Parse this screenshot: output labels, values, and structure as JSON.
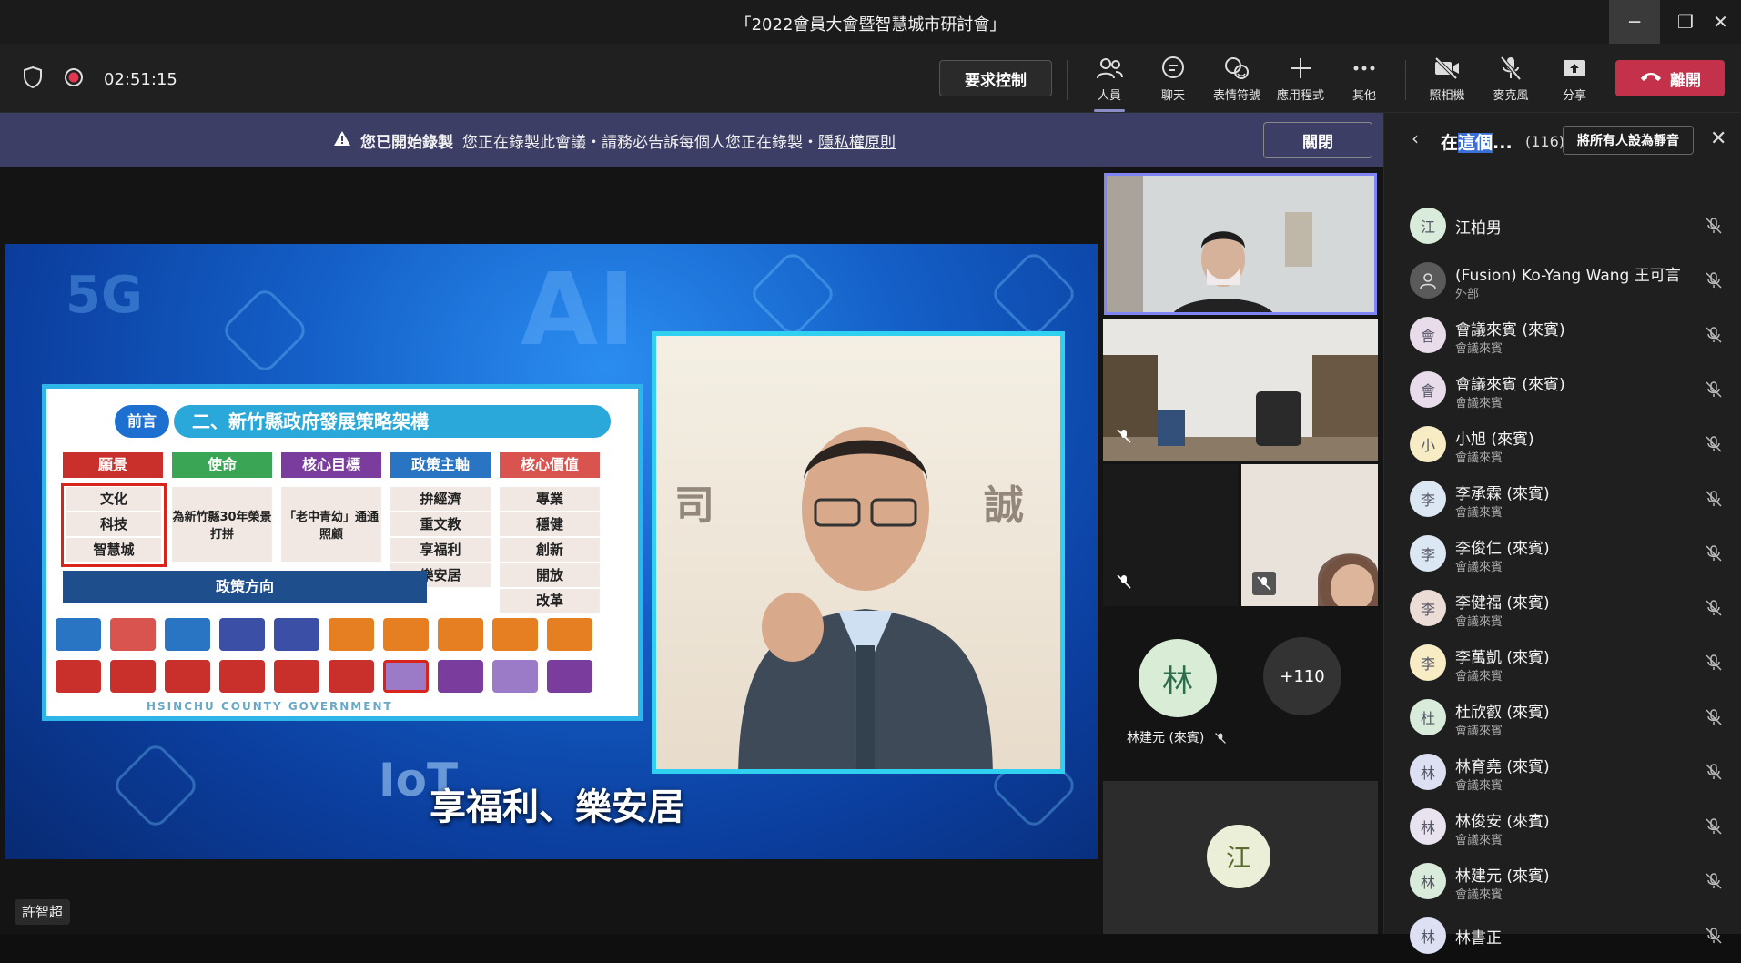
{
  "window": {
    "title": "「2022會員大會暨智慧城市研討會」",
    "minimize": "─",
    "restore": "❐",
    "close": "✕"
  },
  "toolbar": {
    "timer": "02:51:15",
    "request_control": "要求控制",
    "items": {
      "people": "人員",
      "chat": "聊天",
      "reactions": "表情符號",
      "apps": "應用程式",
      "more": "其他",
      "camera": "照相機",
      "mic": "麥克風",
      "share": "分享"
    },
    "leave": "離開"
  },
  "banner": {
    "bold": "您已開始錄製",
    "text": "您正在錄製此會議・請務必告訴每個人您正在錄製・",
    "link": "隱私權原則",
    "close": "關閉"
  },
  "slide": {
    "tag": "前言",
    "title": "二、新竹縣政府發展策略架構",
    "headers": [
      "願景",
      "使命",
      "核心目標",
      "政策主軸",
      "核心價值"
    ],
    "vision": [
      "文化",
      "科技",
      "智慧城"
    ],
    "mission": "為新竹縣30年榮景打拼",
    "goal": "「老中青幼」通通照顧",
    "policy_axes": [
      "拚經濟",
      "重文教",
      "享福利",
      "樂安居"
    ],
    "values": [
      "專業",
      "穩健",
      "創新",
      "開放",
      "改革"
    ],
    "policy_direction": "政策方向",
    "footer": "HSINCHU COUNTY GOVERNMENT",
    "caption": "享福利、樂安居",
    "overlay_words": [
      "5G",
      "AI",
      "IoT"
    ]
  },
  "presenter_name": "許智超",
  "tiles": {
    "avatar_initial": "林",
    "avatar_name": "林建元 (來賓)",
    "more_count": "+110",
    "bottom_initial": "江"
  },
  "panel": {
    "title": "在這個...",
    "title_sel": "這個",
    "count": "(116)",
    "mute_all": "將所有人設為靜音",
    "participants": [
      {
        "initial": "江",
        "name": "江柏男",
        "sub": "",
        "color": "#d9ecdc"
      },
      {
        "initial": "",
        "name": "(Fusion) Ko-Yang Wang 王可言",
        "sub": "外部",
        "color": "#5a5a5a"
      },
      {
        "initial": "會",
        "name": "會議來賓 (來賓)",
        "sub": "會議來賓",
        "color": "#e9dcea"
      },
      {
        "initial": "會",
        "name": "會議來賓 (來賓)",
        "sub": "會議來賓",
        "color": "#e9dcea"
      },
      {
        "initial": "小",
        "name": "小旭 (來賓)",
        "sub": "會議來賓",
        "color": "#f7ecc4"
      },
      {
        "initial": "李",
        "name": "李承霖 (來賓)",
        "sub": "會議來賓",
        "color": "#dbe7f2"
      },
      {
        "initial": "李",
        "name": "李俊仁 (來賓)",
        "sub": "會議來賓",
        "color": "#dbe7f2"
      },
      {
        "initial": "李",
        "name": "李健福 (來賓)",
        "sub": "會議來賓",
        "color": "#ecdcd6"
      },
      {
        "initial": "李",
        "name": "李萬凱 (來賓)",
        "sub": "會議來賓",
        "color": "#f7ecc4"
      },
      {
        "initial": "杜",
        "name": "杜欣叡 (來賓)",
        "sub": "會議來賓",
        "color": "#d9ecdc"
      },
      {
        "initial": "林",
        "name": "林育堯 (來賓)",
        "sub": "會議來賓",
        "color": "#dde0f2"
      },
      {
        "initial": "林",
        "name": "林俊安 (來賓)",
        "sub": "會議來賓",
        "color": "#e9e3ef"
      },
      {
        "initial": "林",
        "name": "林建元 (來賓)",
        "sub": "會議來賓",
        "color": "#d9ecdc"
      },
      {
        "initial": "林",
        "name": "林書正",
        "sub": "",
        "color": "#dde0f2"
      }
    ]
  },
  "colors": {
    "banner": "#3d3e66",
    "leave": "#c4314b",
    "accent": "#7f85f5"
  }
}
